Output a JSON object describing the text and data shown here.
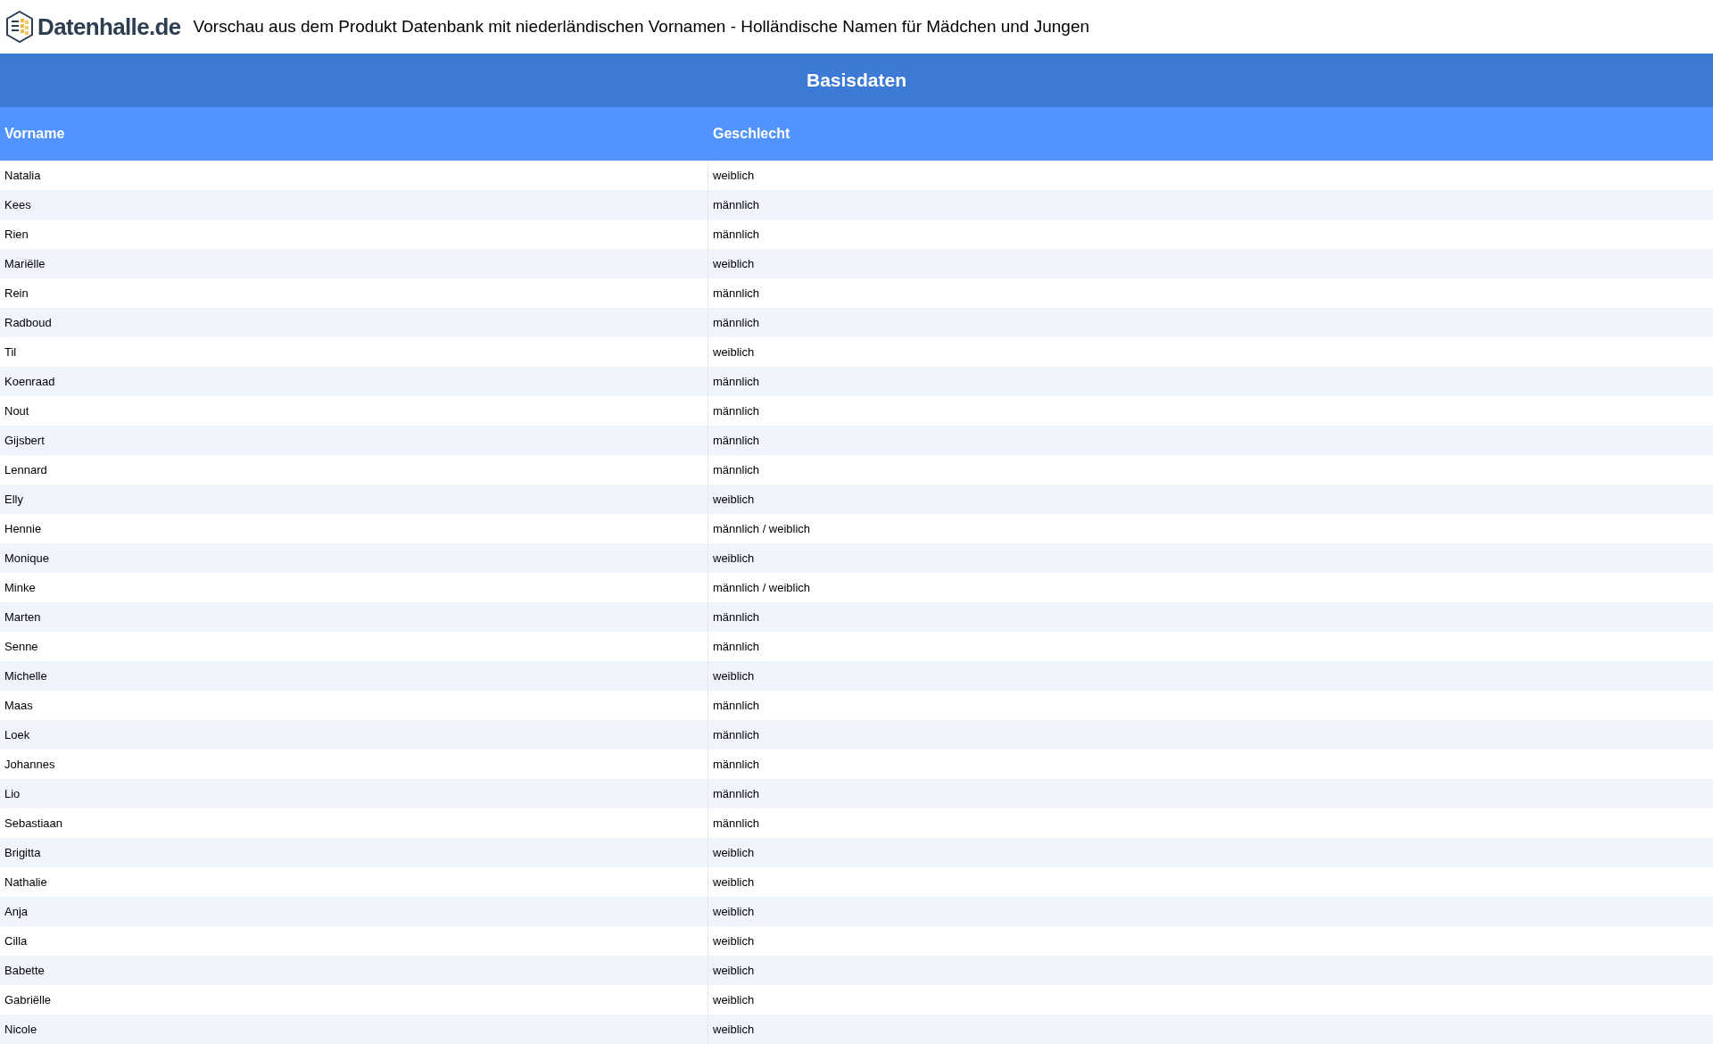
{
  "header": {
    "brand": "Datenhalle.de",
    "title": "Vorschau aus dem Produkt Datenbank mit niederländischen Vornamen - Holländische Namen für Mädchen und Jungen"
  },
  "table": {
    "caption": "Basisdaten",
    "columns": [
      "Vorname",
      "Geschlecht"
    ],
    "rows": [
      [
        "Natalia",
        "weiblich"
      ],
      [
        "Kees",
        "männlich"
      ],
      [
        "Rien",
        "männlich"
      ],
      [
        "Mariëlle",
        "weiblich"
      ],
      [
        "Rein",
        "männlich"
      ],
      [
        "Radboud",
        "männlich"
      ],
      [
        "Til",
        "weiblich"
      ],
      [
        "Koenraad",
        "männlich"
      ],
      [
        "Nout",
        "männlich"
      ],
      [
        "Gijsbert",
        "männlich"
      ],
      [
        "Lennard",
        "männlich"
      ],
      [
        "Elly",
        "weiblich"
      ],
      [
        "Hennie",
        "männlich / weiblich"
      ],
      [
        "Monique",
        "weiblich"
      ],
      [
        "Minke",
        "männlich / weiblich"
      ],
      [
        "Marten",
        "männlich"
      ],
      [
        "Senne",
        "männlich"
      ],
      [
        "Michelle",
        "weiblich"
      ],
      [
        "Maas",
        "männlich"
      ],
      [
        "Loek",
        "männlich"
      ],
      [
        "Johannes",
        "männlich"
      ],
      [
        "Lio",
        "männlich"
      ],
      [
        "Sebastiaan",
        "männlich"
      ],
      [
        "Brigitta",
        "weiblich"
      ],
      [
        "Nathalie",
        "weiblich"
      ],
      [
        "Anja",
        "weiblich"
      ],
      [
        "Cilla",
        "weiblich"
      ],
      [
        "Babette",
        "weiblich"
      ],
      [
        "Gabriëlle",
        "weiblich"
      ],
      [
        "Nicole",
        "weiblich"
      ]
    ]
  }
}
